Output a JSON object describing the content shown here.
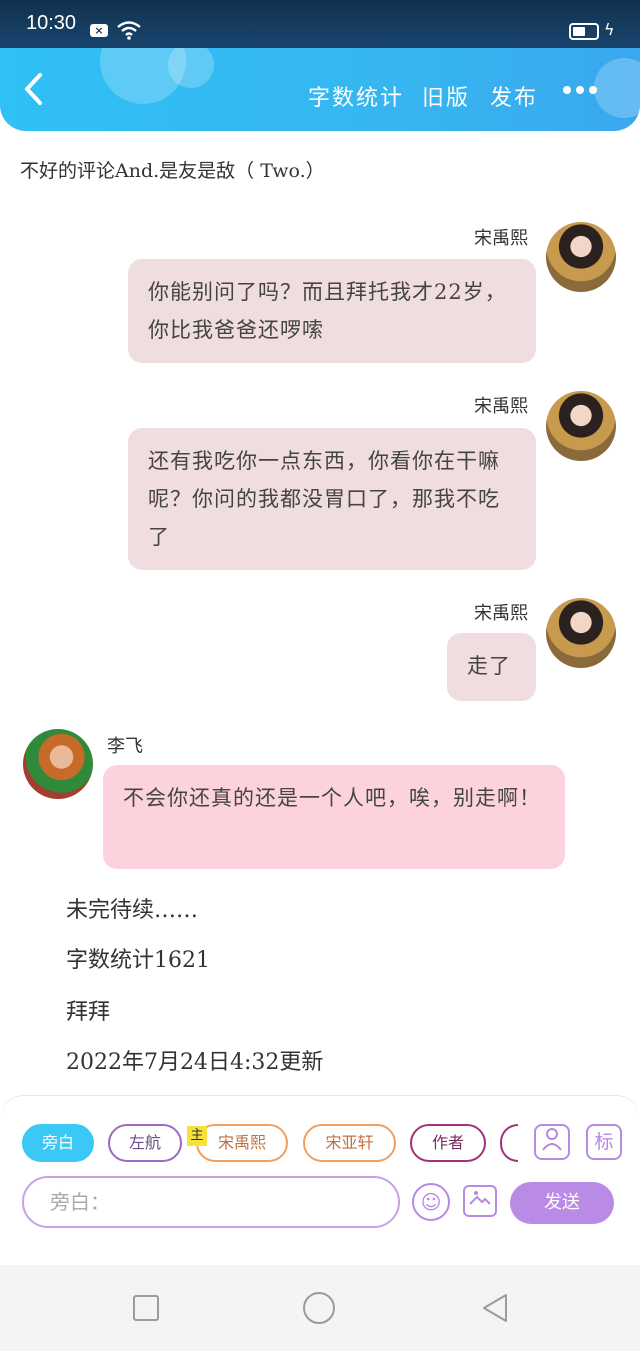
{
  "status_bar": {
    "time": "10:30",
    "notification_icon": "x-box-icon",
    "wifi_icon": "wifi-icon",
    "battery_icon": "battery-charging-icon"
  },
  "header": {
    "back_icon": "chevron-left-icon",
    "word_count_label": "字数统计",
    "old_version_label": "旧版",
    "publish_label": "发布",
    "more_icon": "more-dots-icon"
  },
  "intro_text": "不好的评论And.是友是敌（ Two.）",
  "messages": [
    {
      "side": "right",
      "name": "宋禹熙",
      "text": "你能别问了吗？而且拜托我才22岁，你比我爸爸还啰嗦"
    },
    {
      "side": "right",
      "name": "宋禹熙",
      "text": "还有我吃你一点东西，你看你在干嘛呢？你问的我都没胃口了，那我不吃了"
    },
    {
      "side": "right",
      "name": "宋禹熙",
      "text": "走了"
    },
    {
      "side": "left",
      "name": "李飞",
      "text": "不会你还真的还是一个人吧，唉，别走啊！"
    }
  ],
  "footer_lines": [
    "未完待续……",
    "字数统计1621",
    "拜拜",
    "2022年7月24日4:32更新"
  ],
  "composer": {
    "chips": [
      "旁白",
      "左航",
      "宋禹熙",
      "宋亚轩",
      "作者"
    ],
    "main_badge": "主",
    "character_icon": "character-card-icon",
    "tag_label": "标",
    "input_placeholder": "旁白：",
    "emoji_icon": "smile-icon",
    "image_icon": "image-icon",
    "send_label": "发送"
  },
  "nav": {
    "recent_icon": "square-icon",
    "home_icon": "circle-icon",
    "back_icon": "triangle-back-icon"
  },
  "colors": {
    "header": "#36b6f0",
    "bubble_right": "#f0dde0",
    "bubble_left": "#fcd3dd",
    "accent_purple": "#b98ae6"
  }
}
